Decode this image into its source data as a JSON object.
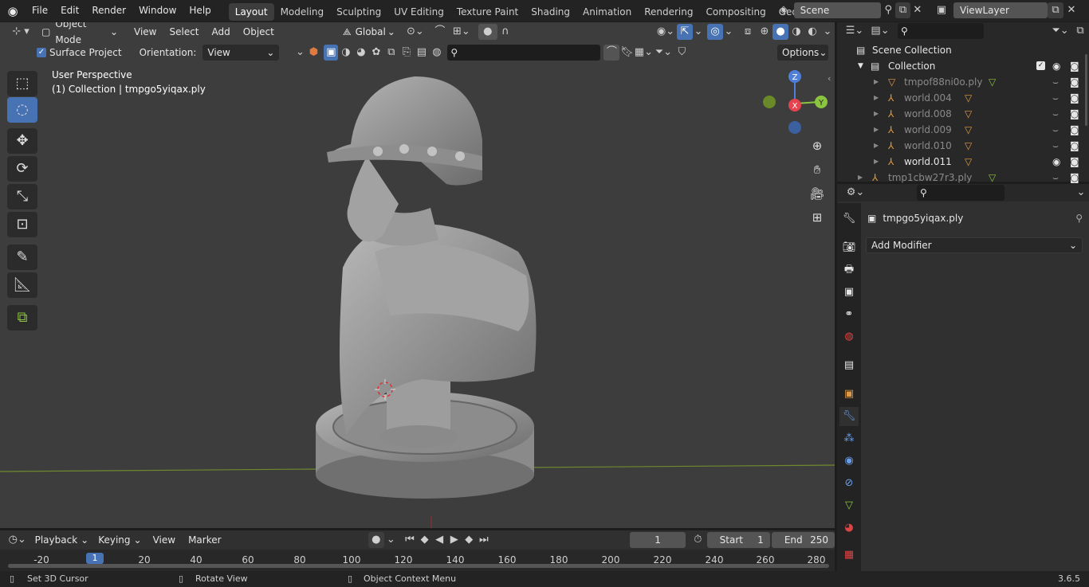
{
  "topbar": {
    "menus": [
      "File",
      "Edit",
      "Render",
      "Window",
      "Help"
    ],
    "workspaces": [
      "Layout",
      "Modeling",
      "Sculpting",
      "UV Editing",
      "Texture Paint",
      "Shading",
      "Animation",
      "Rendering",
      "Compositing",
      "Geometry Noc"
    ],
    "scene": "Scene",
    "view_layer": "ViewLayer"
  },
  "viewport": {
    "mode": "Object Mode",
    "menus": [
      "View",
      "Select",
      "Add",
      "Object"
    ],
    "transform_orientation": "Global",
    "surface_project_label": "Surface Project",
    "orientation_label": "Orientation:",
    "orientation_value": "View",
    "options_label": "Options",
    "perspective_label": "User Perspective",
    "collection_label": "(1) Collection | tmpgo5yiqax.ply",
    "gizmo": {
      "z": "Z",
      "x": "X",
      "y": "Y"
    }
  },
  "outliner": {
    "scene_collection": "Scene Collection",
    "collection": "Collection",
    "items": [
      {
        "name": "tmpof88ni0o.ply",
        "dim": true
      },
      {
        "name": "world.004",
        "dim": true
      },
      {
        "name": "world.008",
        "dim": true
      },
      {
        "name": "world.009",
        "dim": true
      },
      {
        "name": "world.010",
        "dim": true
      },
      {
        "name": "world.011",
        "dim": false
      },
      {
        "name": "tmp1cbw27r3.ply",
        "dim": true
      }
    ]
  },
  "properties": {
    "object_name": "tmpgo5yiqax.ply",
    "add_modifier": "Add Modifier"
  },
  "timeline": {
    "playback": "Playback",
    "keying": "Keying",
    "view": "View",
    "marker": "Marker",
    "current_frame": "1",
    "start_label": "Start",
    "start_value": "1",
    "end_label": "End",
    "end_value": "250",
    "current_marker": "1",
    "ticks": [
      "-20",
      "20",
      "40",
      "60",
      "80",
      "100",
      "120",
      "140",
      "160",
      "180",
      "200",
      "220",
      "240",
      "260",
      "280"
    ]
  },
  "statusbar": {
    "hint1": "Set 3D Cursor",
    "hint2": "Rotate View",
    "hint3": "Object Context Menu",
    "version": "3.6.5"
  },
  "colors": {
    "accent": "#4772b3",
    "x_axis": "#e5434e",
    "y_axis": "#8bc53f",
    "z_axis": "#4f7fd6",
    "object_orange": "#e09a44"
  }
}
